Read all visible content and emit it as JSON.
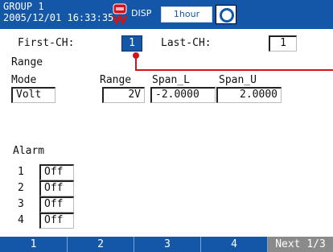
{
  "header": {
    "group": "GROUP 1",
    "datetime": "2005/12/01 16:33:35",
    "disp_label": "DISP",
    "interval": "1hour"
  },
  "channel": {
    "first_label": "First-CH:",
    "first_value": "1",
    "last_label": "Last-CH:",
    "last_value": "1"
  },
  "range": {
    "section_title": "Range",
    "mode_label": "Mode",
    "range_label": "Range",
    "span_l_label": "Span_L",
    "span_u_label": "Span_U",
    "mode_value": "Volt",
    "range_value": "2V",
    "span_l_value": "-2.0000",
    "span_u_value": "2.0000"
  },
  "alarm": {
    "title": "Alarm",
    "items": [
      {
        "num": "1",
        "value": "Off"
      },
      {
        "num": "2",
        "value": "Off"
      },
      {
        "num": "3",
        "value": "Off"
      },
      {
        "num": "4",
        "value": "Off"
      }
    ]
  },
  "softkeys": {
    "k1": "1",
    "k2": "2",
    "k3": "3",
    "k4": "4",
    "next": "Next 1/3"
  },
  "colors": {
    "header_bg": "#1457a8",
    "accent_red": "#d1141c",
    "next_bg": "#8a8a8a"
  }
}
